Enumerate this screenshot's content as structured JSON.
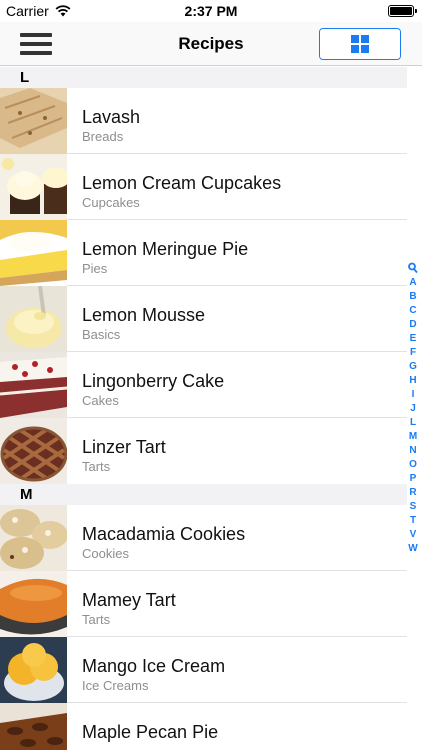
{
  "status_bar": {
    "carrier": "Carrier",
    "time": "2:37 PM"
  },
  "nav": {
    "title": "Recipes"
  },
  "colors": {
    "accent": "#1a7cf2"
  },
  "sections": [
    {
      "letter": "L",
      "items": [
        {
          "title": "Lavash",
          "category": "Breads"
        },
        {
          "title": "Lemon Cream Cupcakes",
          "category": "Cupcakes"
        },
        {
          "title": "Lemon Meringue Pie",
          "category": "Pies"
        },
        {
          "title": "Lemon Mousse",
          "category": "Basics"
        },
        {
          "title": "Lingonberry Cake",
          "category": "Cakes"
        },
        {
          "title": "Linzer Tart",
          "category": "Tarts"
        }
      ]
    },
    {
      "letter": "M",
      "items": [
        {
          "title": "Macadamia Cookies",
          "category": "Cookies"
        },
        {
          "title": "Mamey Tart",
          "category": "Tarts"
        },
        {
          "title": "Mango Ice Cream",
          "category": "Ice Creams"
        },
        {
          "title": "Maple Pecan Pie",
          "category": ""
        }
      ]
    }
  ],
  "index": [
    "A",
    "B",
    "C",
    "D",
    "E",
    "F",
    "G",
    "H",
    "I",
    "J",
    "L",
    "M",
    "N",
    "O",
    "P",
    "R",
    "S",
    "T",
    "V",
    "W"
  ]
}
